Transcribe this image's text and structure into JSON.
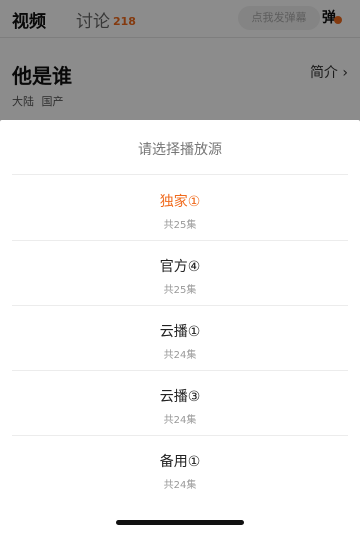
{
  "tabs": {
    "video": "视频",
    "discuss": "讨论",
    "discuss_count": "218"
  },
  "danmaku": {
    "placeholder": "点我发弹幕",
    "icon_label": "弹"
  },
  "show": {
    "title": "他是谁",
    "intro_link": "简介 ›",
    "meta": "大陆 国产"
  },
  "sheet": {
    "title": "请选择播放源",
    "sources": [
      {
        "name": "独家①",
        "count": "共25集",
        "selected": true
      },
      {
        "name": "官方④",
        "count": "共25集",
        "selected": false
      },
      {
        "name": "云播①",
        "count": "共24集",
        "selected": false
      },
      {
        "name": "云播③",
        "count": "共24集",
        "selected": false
      },
      {
        "name": "备用①",
        "count": "共24集",
        "selected": false
      }
    ]
  },
  "colors": {
    "accent": "#f06a1c",
    "overlay": "#00000073"
  }
}
